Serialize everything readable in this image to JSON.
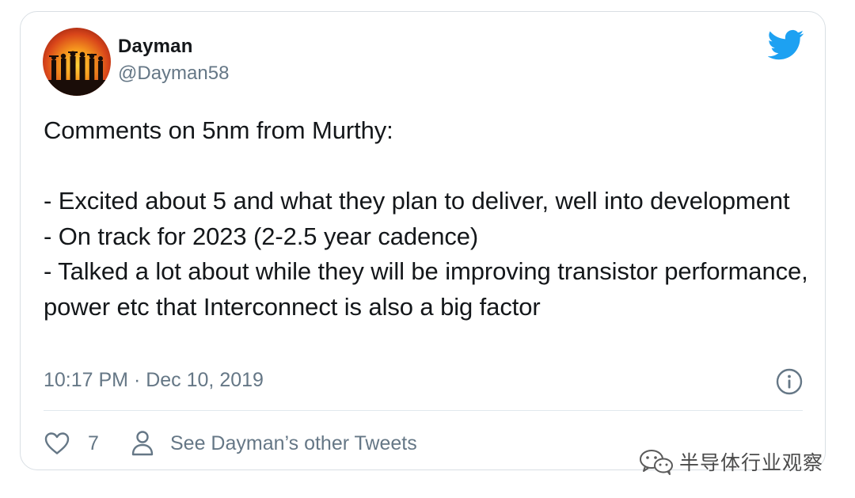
{
  "tweet": {
    "author_name": "Dayman",
    "author_handle": "@Dayman58",
    "text": "Comments on 5nm from Murthy:\n\n- Excited about 5 and what they plan to deliver, well into development\n- On track for 2023 (2-2.5 year cadence)\n- Talked a lot about while they will be improving transistor performance, power etc that Interconnect is also a big factor",
    "timestamp": "10:17 PM · Dec 10, 2019",
    "like_count": "7",
    "profile_link_label": "See Dayman’s other Tweets"
  },
  "icons": {
    "brand": "twitter-bird-icon",
    "info": "info-icon",
    "like": "heart-icon",
    "profile": "person-icon",
    "watermark": "wechat-icon"
  },
  "watermark": {
    "text": "半导体行业观察"
  },
  "colors": {
    "twitter_blue": "#1da1f2",
    "text_primary": "#14171a",
    "text_secondary": "#657786",
    "border": "#d9dfe4"
  }
}
